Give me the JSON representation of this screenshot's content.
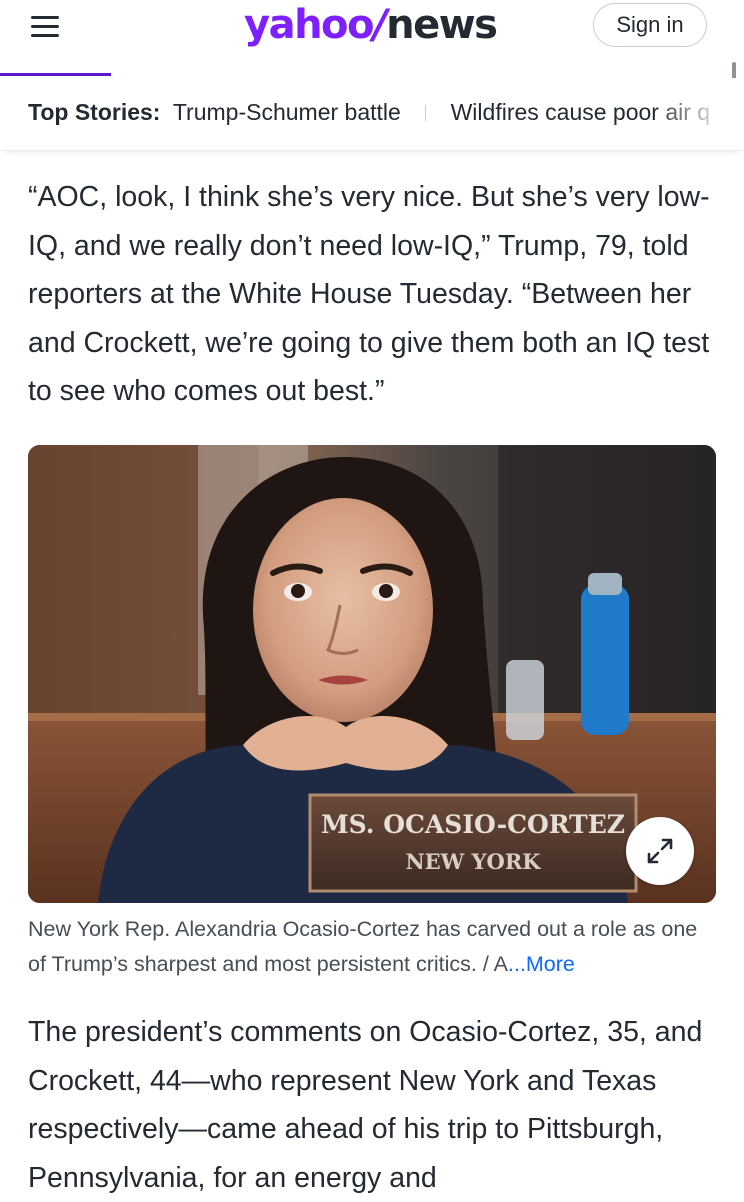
{
  "header": {
    "logo_yahoo": "yahoo",
    "logo_slash": "/",
    "logo_news": "news",
    "sign_in_label": "Sign in",
    "brand_color": "#7e1fff",
    "menu_icon": "hamburger-menu-icon"
  },
  "top_stories": {
    "label": "Top Stories:",
    "items": [
      "Trump-Schumer battle",
      "Wildfires cause poor air q"
    ]
  },
  "article": {
    "paragraph_1": "“AOC, look, I think she’s very nice. But she’s very low-IQ, and we really don’t need low-IQ,” Trump, 79, told reporters at the White House Tuesday. “Between her and Crockett, we’re going to give them both an IQ test to see who comes out best.”",
    "image": {
      "nameplate_line_1": "MS. OCASIO-CORTEZ",
      "nameplate_line_2": "NEW YORK",
      "expand_icon": "expand-arrows-icon"
    },
    "caption": "New York Rep. Alexandria Ocasio-Cortez has carved out a role as one of Trump’s sharpest and most persistent critics. / A",
    "caption_more": "...More",
    "link_color": "#0f69ff",
    "paragraph_2": "The president’s comments on Ocasio-Cortez, 35, and Crockett, 44—who represent New York and Texas respectively—came ahead of his trip to Pittsburgh, Pennsylvania, for an energy and"
  }
}
